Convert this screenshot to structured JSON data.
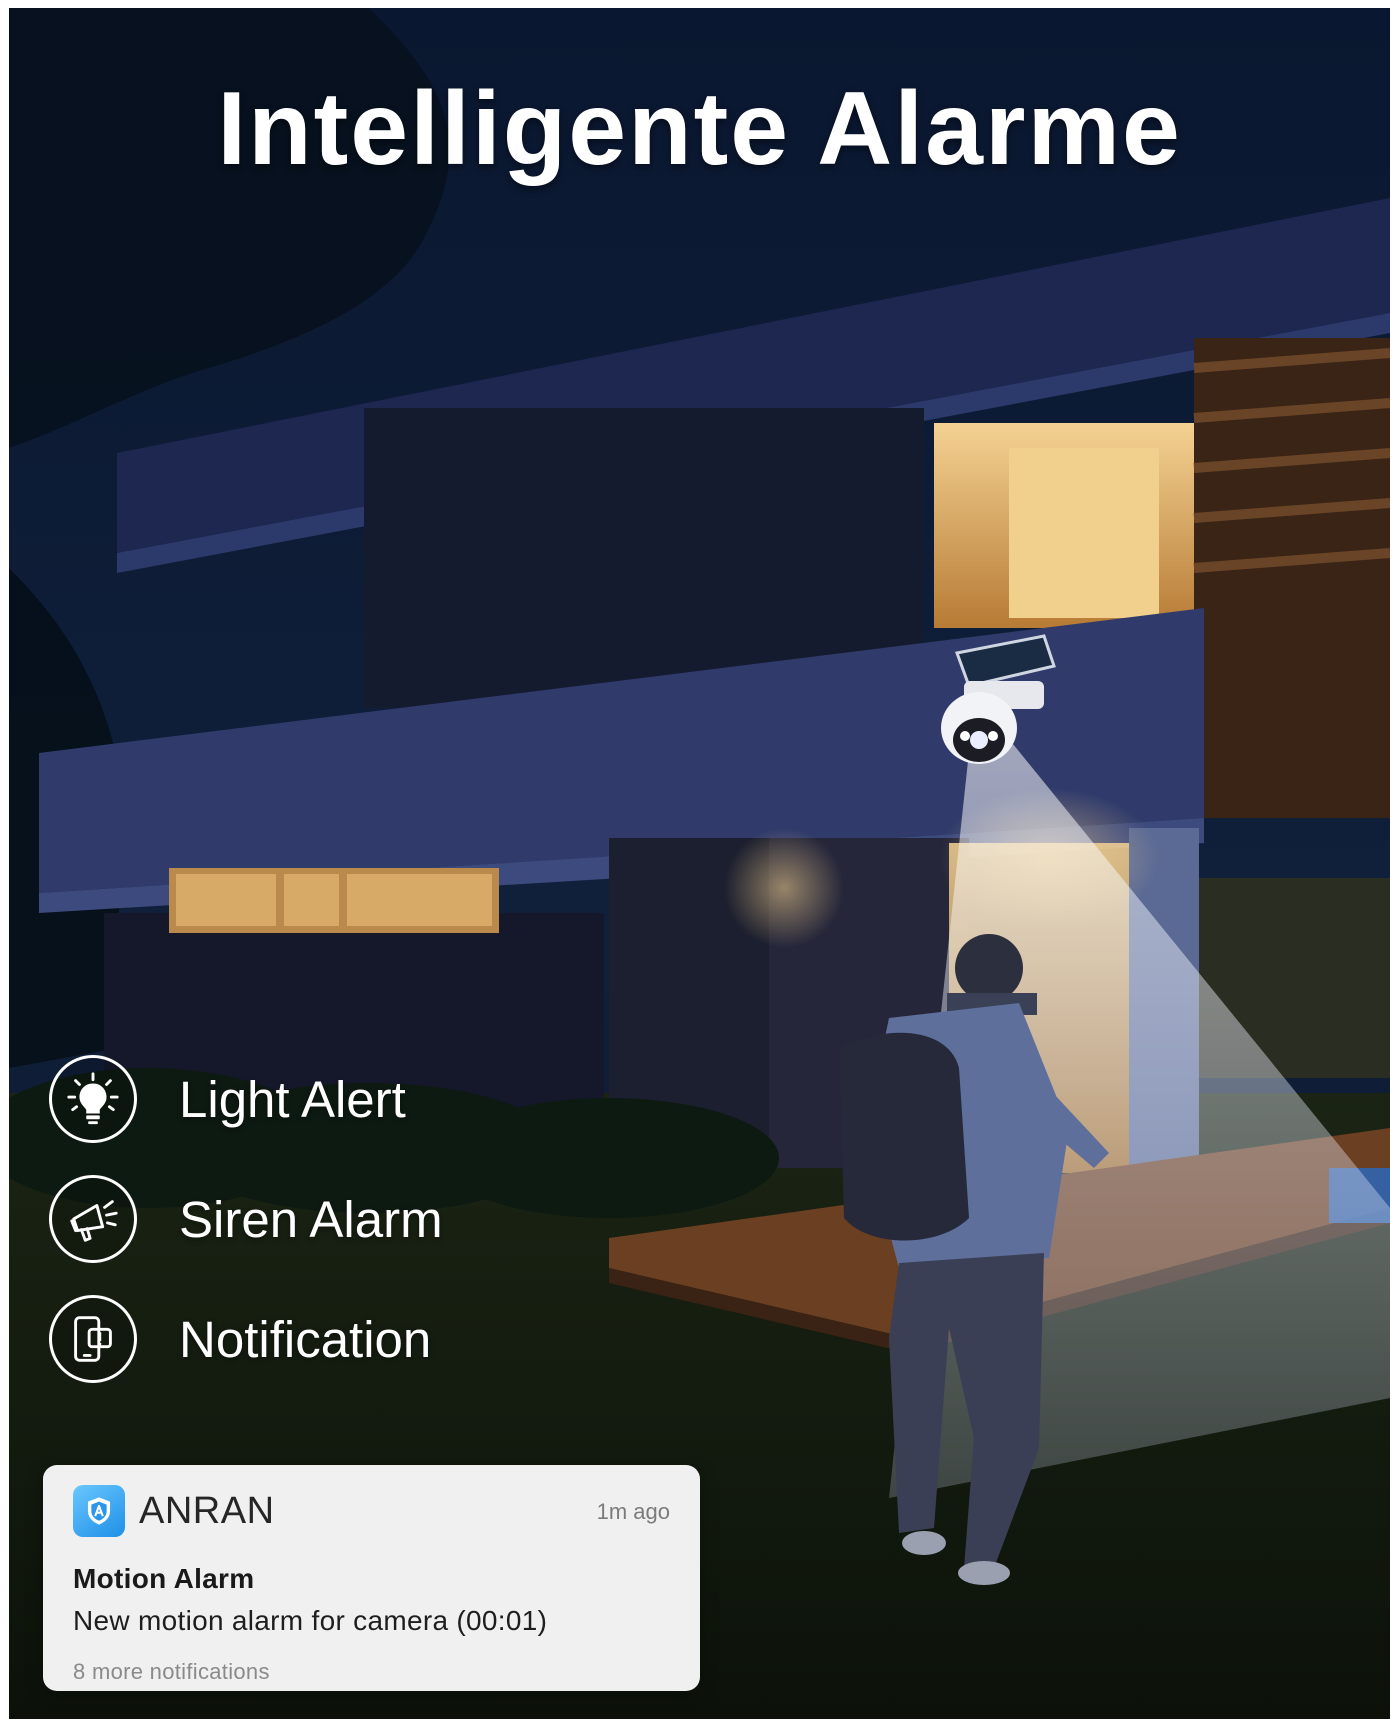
{
  "headline": "Intelligente Alarme",
  "features": [
    {
      "label": "Light Alert",
      "icon": "light-bulb-icon"
    },
    {
      "label": "Siren Alarm",
      "icon": "megaphone-icon"
    },
    {
      "label": "Notification",
      "icon": "phone-alert-icon"
    }
  ],
  "notification": {
    "app_name": "ANRAN",
    "app_icon": "anran-shield-logo",
    "time": "1m ago",
    "title": "Motion Alarm",
    "message": "New motion alarm for camera (00:01)",
    "more": "8 more notifications"
  },
  "colors": {
    "night_sky": "#0b1526",
    "text": "#ffffff",
    "notification_bg": "#f0f0f1",
    "app_icon_blue": "#1f8fe6"
  }
}
